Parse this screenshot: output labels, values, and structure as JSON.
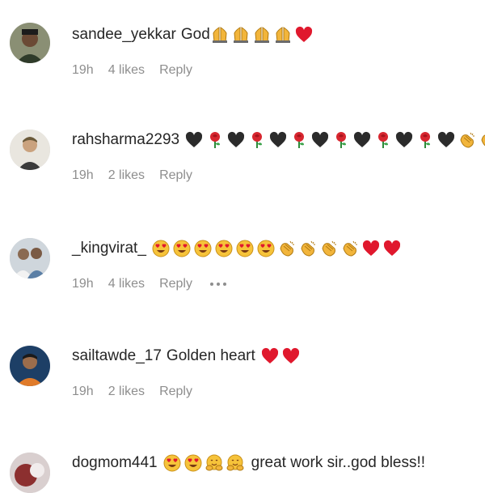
{
  "comments": [
    {
      "username": "sandee_yekkar",
      "text": "God",
      "emojis": [
        "pray",
        "pray",
        "pray",
        "pray",
        "heart"
      ],
      "time": "19h",
      "likes": "4 likes",
      "reply": "Reply",
      "has_more": false
    },
    {
      "username": "rahsharma2293",
      "text": "",
      "emojis": [
        "black-heart",
        "rose",
        "black-heart",
        "rose",
        "black-heart",
        "rose",
        "black-heart",
        "rose",
        "black-heart",
        "rose",
        "black-heart",
        "rose",
        "black-heart",
        "clap",
        "clap"
      ],
      "time": "19h",
      "likes": "2 likes",
      "reply": "Reply",
      "has_more": false
    },
    {
      "username": "_kingvirat_",
      "text": "",
      "emojis": [
        "heart-eyes",
        "heart-eyes",
        "heart-eyes",
        "heart-eyes",
        "heart-eyes",
        "heart-eyes",
        "clap",
        "clap",
        "clap",
        "clap",
        "heart",
        "heart"
      ],
      "time": "19h",
      "likes": "4 likes",
      "reply": "Reply",
      "has_more": true
    },
    {
      "username": "sailtawde_17",
      "text": "Golden heart",
      "emojis": [
        "heart",
        "heart"
      ],
      "time": "19h",
      "likes": "2 likes",
      "reply": "Reply",
      "has_more": false
    },
    {
      "username": "dogmom441",
      "text": "great work sir..god bless!!",
      "emojis": [
        "heart-eyes",
        "heart-eyes",
        "hug",
        "hug"
      ],
      "time": "",
      "likes": "",
      "reply": "",
      "has_more": false
    }
  ]
}
